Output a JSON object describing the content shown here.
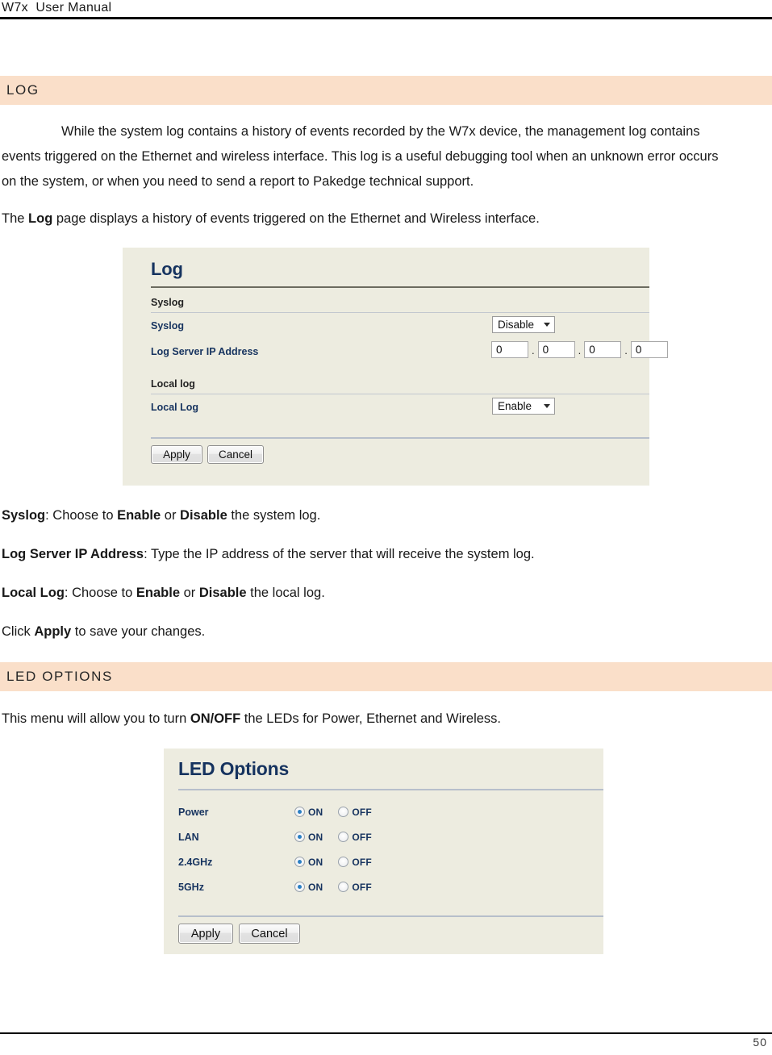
{
  "header": {
    "running_title": "W7x  User Manual"
  },
  "footer": {
    "page_number": "50"
  },
  "sections": {
    "log": {
      "heading": "LOG",
      "paragraph_1": "While the system log contains a history of events recorded by the W7x device, the management log contains events triggered on the Ethernet and wireless interface. This log is a useful debugging tool when an unknown error occurs on the system, or when you need to send a report to Pakedge technical support.",
      "paragraph_2_pre": "The ",
      "paragraph_2_bold": "Log",
      "paragraph_2_post": " page displays a history of events triggered on the Ethernet and Wireless interface.",
      "descriptions": [
        {
          "term": "Syslog",
          "text_1": ": Choose to ",
          "bold_1": "Enable",
          "text_2": " or ",
          "bold_2": "Disable",
          "text_3": " the system log."
        },
        {
          "term": "Log Server IP Address",
          "text_1": ": Type the IP address of the server that will receive the system log.",
          "bold_1": "",
          "text_2": "",
          "bold_2": "",
          "text_3": ""
        },
        {
          "term": "Local Log",
          "text_1": ": Choose to ",
          "bold_1": "Enable",
          "text_2": " or ",
          "bold_2": "Disable",
          "text_3": " the local log."
        }
      ],
      "apply_note_pre": "Click ",
      "apply_note_bold": "Apply",
      "apply_note_post": " to save your changes."
    },
    "led_options": {
      "heading": "LED OPTIONS",
      "paragraph_pre": "This menu will allow you to turn ",
      "paragraph_bold": "ON/OFF",
      "paragraph_post": " the LEDs for Power, Ethernet and Wireless."
    }
  },
  "log_panel": {
    "title": "Log",
    "group_syslog": "Syslog",
    "group_local_log": "Local log",
    "syslog_label": "Syslog",
    "syslog_value": "Disable",
    "syslog_options": [
      "Enable",
      "Disable"
    ],
    "ip_label": "Log Server IP Address",
    "ip_octets": [
      "0",
      "0",
      "0",
      "0"
    ],
    "ip_separator": ".",
    "local_log_label": "Local Log",
    "local_log_value": "Enable",
    "local_log_options": [
      "Enable",
      "Disable"
    ],
    "apply_label": "Apply",
    "cancel_label": "Cancel"
  },
  "led_panel": {
    "title": "LED Options",
    "on_label": "ON",
    "off_label": "OFF",
    "rows": [
      {
        "label": "Power",
        "selected": "ON"
      },
      {
        "label": "LAN",
        "selected": "ON"
      },
      {
        "label": "2.4GHz",
        "selected": "ON"
      },
      {
        "label": "5GHz",
        "selected": "ON"
      }
    ],
    "apply_label": "Apply",
    "cancel_label": "Cancel"
  },
  "colors": {
    "section_band": "#FADFC9",
    "ui_background": "#EDECE0",
    "ui_title": "#16335F",
    "radio_dot": "#2B7FC4"
  }
}
